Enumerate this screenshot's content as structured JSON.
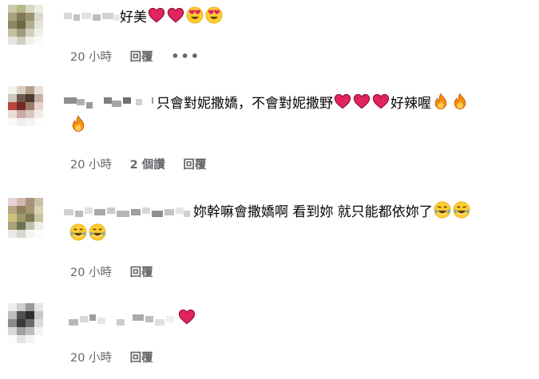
{
  "comments": [
    {
      "text_before": "",
      "text": "好美",
      "emoji": [
        "heart",
        "heart",
        "heart-eyes",
        "heart-eyes"
      ],
      "emoji_line2": [],
      "meta": {
        "time": "20 小時",
        "likes": "",
        "reply": "回覆",
        "more": "•••"
      }
    },
    {
      "text": "只會對妮撒嬌，不會對妮撒野",
      "emoji": [
        "heart",
        "heart",
        "heart"
      ],
      "text_after": "好辣喔",
      "emoji_after": [
        "fire",
        "fire"
      ],
      "emoji_line2": [
        "fire"
      ],
      "meta": {
        "time": "20 小時",
        "likes": "2 個讚",
        "reply": "回覆"
      }
    },
    {
      "text": "妳幹嘛會撒嬌啊 看到妳 就只能都依妳了",
      "emoji": [
        "tears-joy",
        "tears-joy"
      ],
      "emoji_line2": [
        "tears-joy",
        "tears-joy"
      ],
      "meta": {
        "time": "20 小時",
        "likes": "",
        "reply": "回覆"
      }
    },
    {
      "text": "",
      "emoji": [
        "heart"
      ],
      "emoji_line2": [],
      "meta": {
        "time": "20 小時",
        "likes": "",
        "reply": "回覆"
      }
    }
  ],
  "colors": {
    "text": "#050505",
    "meta": "#65676b",
    "heart": "#e0245e",
    "face": "#ffcc33",
    "fire": "#f4900c"
  }
}
